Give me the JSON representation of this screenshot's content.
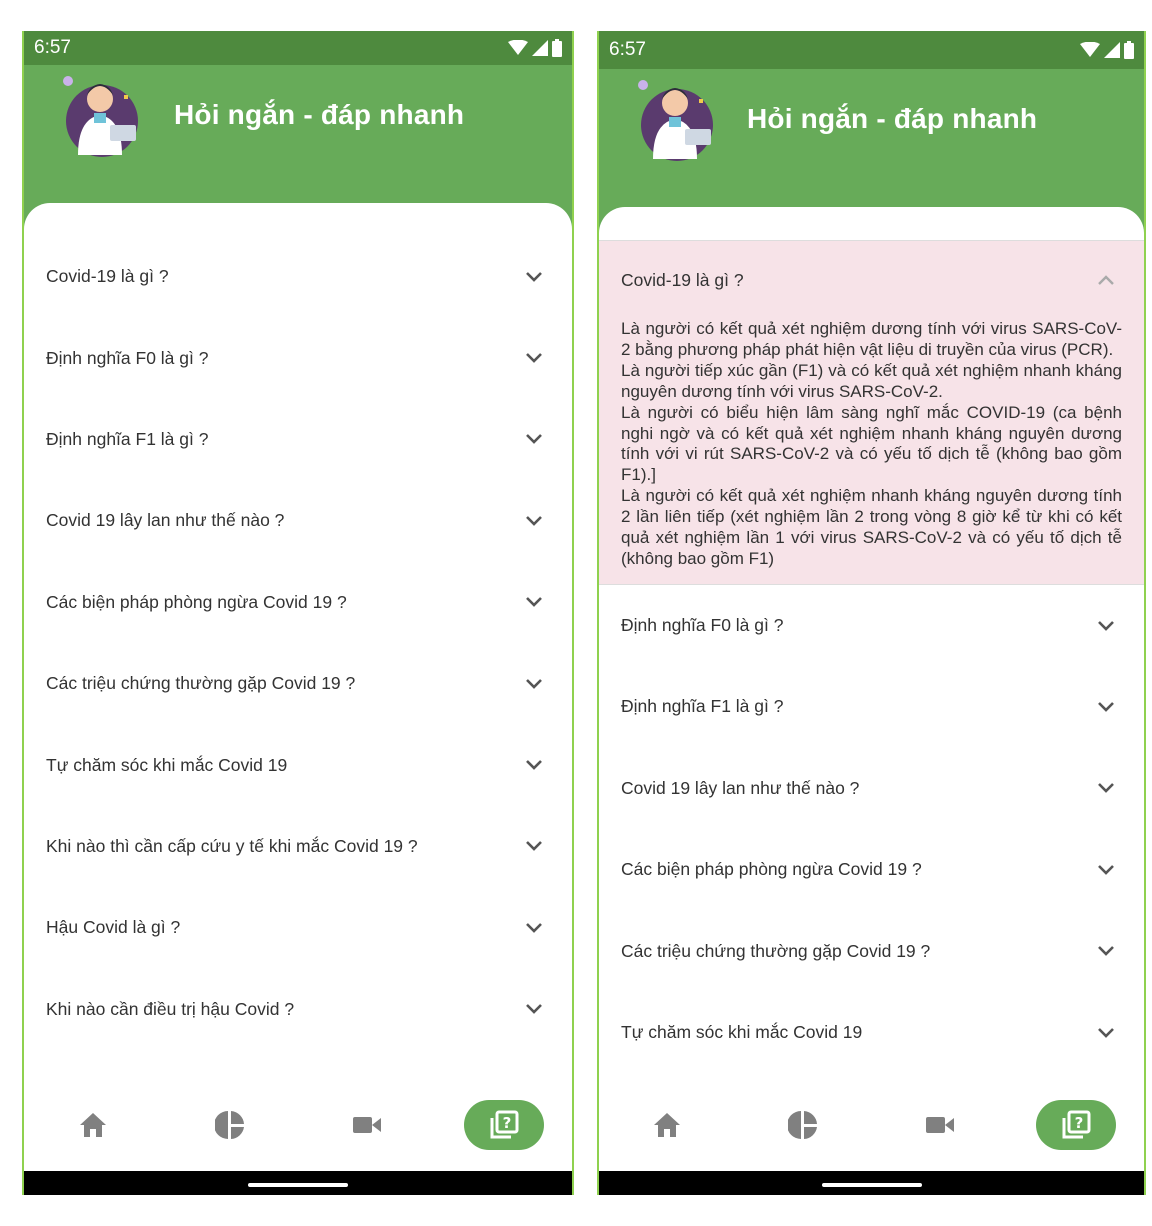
{
  "status_bar": {
    "time": "6:57"
  },
  "header": {
    "title": "Hỏi ngắn - đáp nhanh"
  },
  "colors": {
    "header_green": "#67ab59",
    "status_green": "#4e8a3e",
    "expanded_bg": "#f7e3e8",
    "frame_accent": "#8fd14f"
  },
  "left_screen": {
    "questions": [
      "Covid-19 là gì ?",
      "Định nghĩa F0 là gì ?",
      "Định nghĩa F1 là gì ?",
      "Covid 19 lây lan như thế nào ?",
      "Các biện pháp phòng ngừa Covid 19 ?",
      "Các triệu chứng thường gặp Covid 19 ?",
      "Tự chăm sóc khi mắc Covid 19",
      "Khi nào thì cần cấp cứu y tế khi mắc Covid 19 ?",
      "Hậu Covid là gì ?",
      "Khi nào cần điều trị hậu Covid ?"
    ]
  },
  "right_screen": {
    "expanded": {
      "question": "Covid-19 là gì ?",
      "answer_lines": [
        "  Là người có kết quả xét nghiệm dương tính với virus SARS-CoV-2 bằng phương pháp phát hiện vật liệu di truyền của virus (PCR).",
        "  Là người tiếp xúc gần (F1) và có kết quả xét nghiệm nhanh kháng nguyên dương tính với virus SARS-CoV-2.",
        "Là người có biểu hiện lâm sàng nghĩ mắc COVID-19 (ca bệnh nghi ngờ và có kết quả xét nghiệm nhanh kháng nguyên dương tính với vi rút SARS-CoV-2 và có yếu tố dịch tễ (không bao gồm F1).]",
        "  Là người có kết quả xét nghiệm nhanh kháng nguyên dương tính 2 lần liên tiếp (xét nghiệm lần 2 trong vòng 8 giờ kể từ khi có kết quả xét nghiệm lần 1 với virus SARS-CoV-2 và có yếu tố dịch tễ (không bao gồm F1)"
      ]
    },
    "questions": [
      "Định nghĩa F0 là gì ?",
      "Định nghĩa F1 là gì ?",
      "Covid 19 lây lan như thế nào ?",
      "Các biện pháp phòng ngừa Covid 19 ?",
      "Các triệu chứng thường gặp Covid 19 ?",
      "Tự chăm sóc khi mắc Covid 19"
    ]
  },
  "nav": {
    "icons": [
      "home-icon",
      "pie-chart-icon",
      "video-camera-icon",
      "question-cards-icon"
    ],
    "active_index": 3
  }
}
